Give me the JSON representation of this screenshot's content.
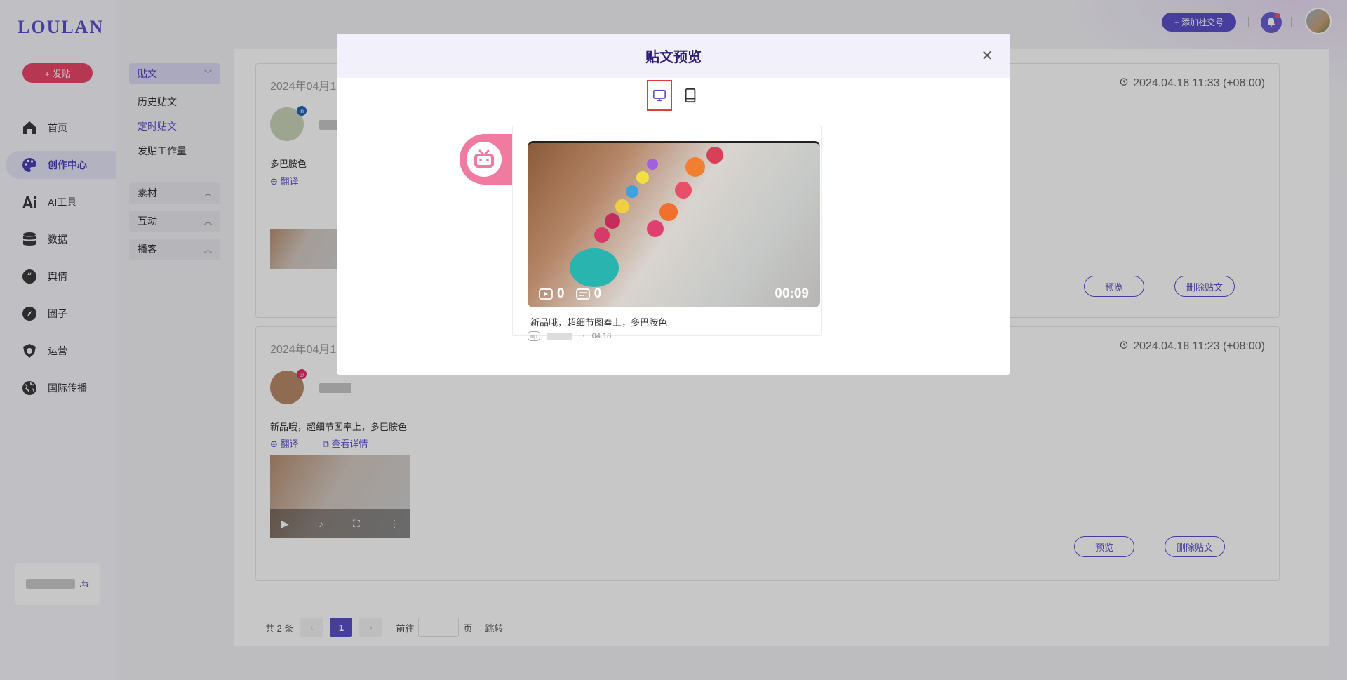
{
  "brand": {
    "logo": "LOULAN",
    "accent": "#5a4fc9",
    "post_color": "#e9476a"
  },
  "sidebar": {
    "post_button": "+ 发贴",
    "items": [
      {
        "label": "首页",
        "icon": "home-icon"
      },
      {
        "label": "创作中心",
        "icon": "palette-icon",
        "active": true
      },
      {
        "label": "AI工具",
        "icon": "ai-icon"
      },
      {
        "label": "数据",
        "icon": "database-icon"
      },
      {
        "label": "舆情",
        "icon": "quote-icon"
      },
      {
        "label": "圈子",
        "icon": "compass-icon"
      },
      {
        "label": "运营",
        "icon": "shield-icon"
      },
      {
        "label": "国际传播",
        "icon": "globe-icon"
      }
    ],
    "account_suffix": "."
  },
  "submenu": {
    "group_posts": "贴文",
    "links": [
      "历史贴文",
      "定时贴文",
      "发贴工作量"
    ],
    "group_material": "素材",
    "group_interact": "互动",
    "group_broadcast": "播客"
  },
  "topbar": {
    "add_social": "+ 添加社交号"
  },
  "posts": [
    {
      "date_left": "2024年04月1",
      "date_right": "2024.04.18 11:33 (+08:00)",
      "text": "多巴胺色",
      "translate": "翻译",
      "preview": "预览",
      "delete": "删除贴文",
      "badge": "in"
    },
    {
      "date_left": "2024年04月1",
      "date_right": "2024.04.18 11:23 (+08:00)",
      "text": "新品哦，超细节图奉上，多巴胺色",
      "translate": "翻译",
      "details": "查看详情",
      "preview": "预览",
      "delete": "删除贴文"
    }
  ],
  "pagination": {
    "total": "共 2 条",
    "current": "1",
    "goto": "前往",
    "page": "页",
    "jump": "跳转"
  },
  "modal": {
    "title": "贴文预览",
    "video": {
      "plays": "0",
      "comments": "0",
      "duration": "00:09"
    },
    "caption": "新品哦，超细节图奉上，多巴胺色",
    "up_tag": "up",
    "meta_sep": "·",
    "date": "04.18"
  }
}
